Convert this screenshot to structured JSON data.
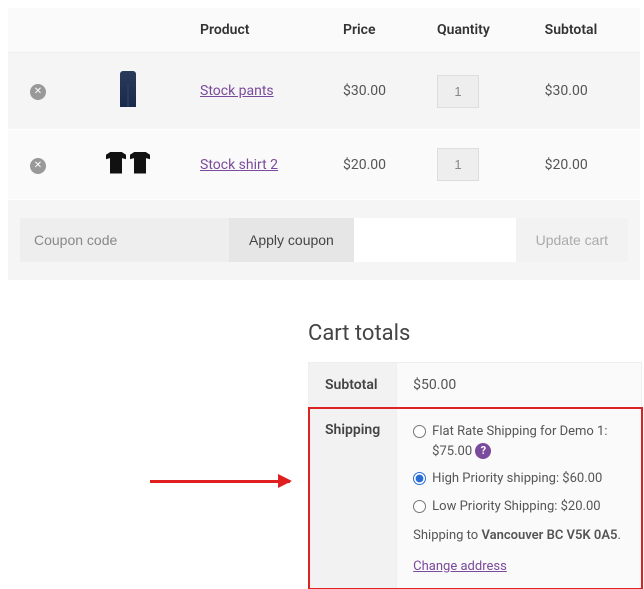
{
  "table": {
    "headers": {
      "product": "Product",
      "price": "Price",
      "quantity": "Quantity",
      "subtotal": "Subtotal"
    },
    "rows": [
      {
        "name": "Stock pants",
        "price": "$30.00",
        "qty": "1",
        "subtotal": "$30.00",
        "thumb": "jeans"
      },
      {
        "name": "Stock shirt 2",
        "price": "$20.00",
        "qty": "1",
        "subtotal": "$20.00",
        "thumb": "shirts"
      }
    ]
  },
  "actions": {
    "coupon_placeholder": "Coupon code",
    "apply_label": "Apply coupon",
    "update_label": "Update cart"
  },
  "totals": {
    "title": "Cart totals",
    "subtotal_label": "Subtotal",
    "subtotal_value": "$50.00",
    "shipping_label": "Shipping",
    "shipping_options": [
      {
        "label": "Flat Rate Shipping for Demo 1: $75.00",
        "checked": false,
        "help": true
      },
      {
        "label": "High Priority shipping: $60.00",
        "checked": true,
        "help": false
      },
      {
        "label": "Low Priority Shipping: $20.00",
        "checked": false,
        "help": false
      }
    ],
    "dest_prefix": "Shipping to ",
    "dest_location": "Vancouver BC V5K 0A5",
    "dest_suffix": ".",
    "change_address": "Change address"
  }
}
